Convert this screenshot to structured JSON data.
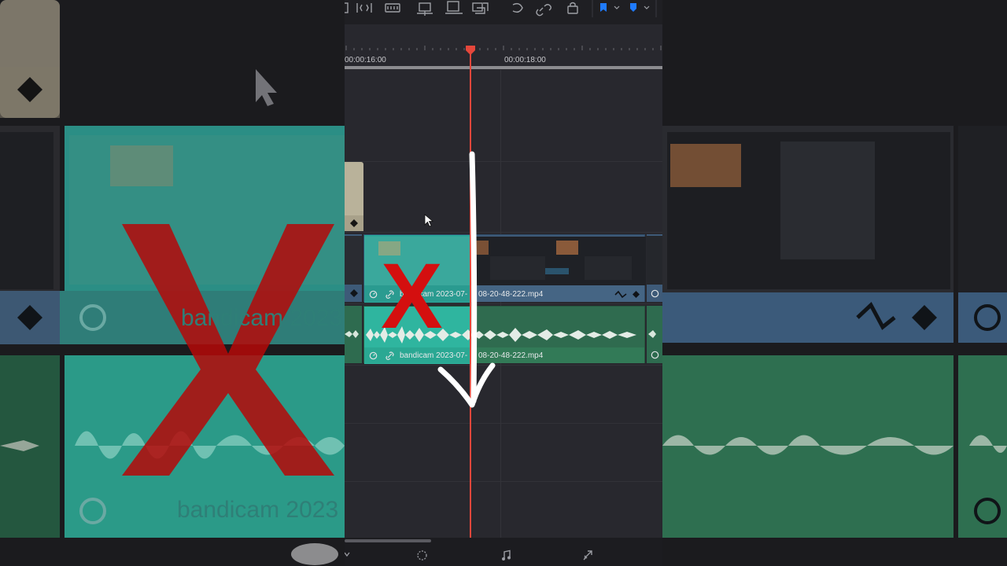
{
  "timeline": {
    "ruler": {
      "left_timecode": "00:00:16:00",
      "right_timecode": "00:00:18:00"
    },
    "video_clip": {
      "name": "bandicam 2023-07-",
      "name_suffix": "08-20-48-222.mp4"
    },
    "audio_clip": {
      "name": "bandicam 2023-07-",
      "name_suffix": "08-20-48-222.mp4"
    }
  },
  "background": {
    "left_label": "bandicam 2023",
    "left_label_bottom": "bandicam 2023"
  },
  "overlay": {
    "cross_mark": "X",
    "arrow_color": "#ffffff",
    "cross_color": "#d40f0f"
  },
  "colors": {
    "playhead": "#e5473b",
    "video_clip_selected": "#2aa79a",
    "video_clip": "#3e5a78",
    "audio_clip_selected": "#2fb59f",
    "audio_clip": "#2e6b4f",
    "flag_blue": "#1f7bff"
  },
  "icons": {
    "toolbar": [
      "trim-icon",
      "dynamic-trim-icon",
      "blade-icon",
      "insert-icon",
      "overwrite-icon",
      "replace-icon",
      "snap-icon",
      "link-icon",
      "lock-icon",
      "flag-icon",
      "marker-icon"
    ],
    "bottom": [
      "effects-icon",
      "audio-icon",
      "deliver-icon"
    ]
  }
}
